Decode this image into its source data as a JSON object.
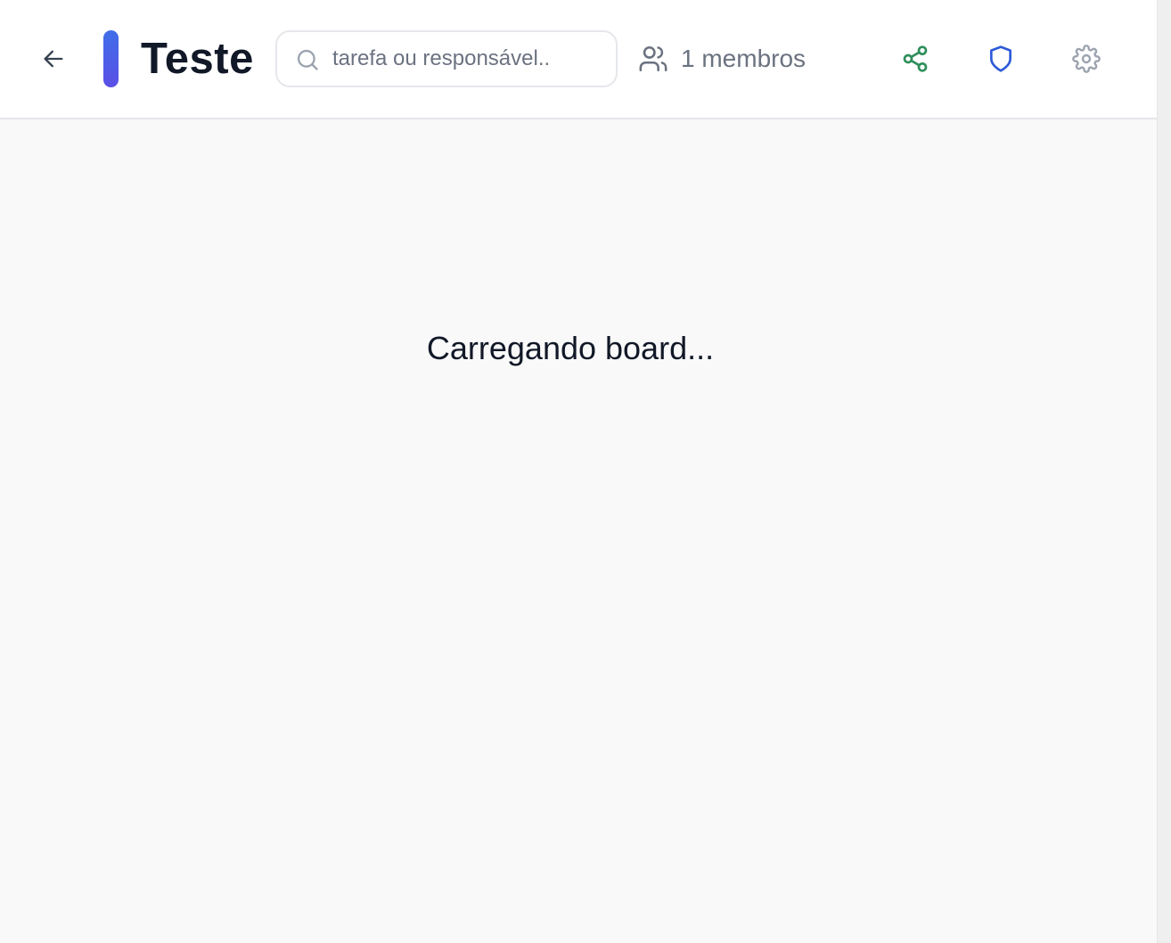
{
  "header": {
    "title": "Teste",
    "accent_color": "#4f5ee7",
    "search": {
      "placeholder": "tarefa ou responsável..",
      "value": ""
    },
    "members_label": "1 membros",
    "icons": {
      "back": "arrow-left-icon",
      "search": "search-icon",
      "members": "users-icon",
      "share": "share-icon",
      "permissions": "shield-icon",
      "settings": "gear-icon"
    },
    "icon_colors": {
      "share": "#2f8f5b",
      "shield": "#2d5bd7",
      "gear": "#9ca3af"
    }
  },
  "main": {
    "loading_text": "Carregando board..."
  }
}
